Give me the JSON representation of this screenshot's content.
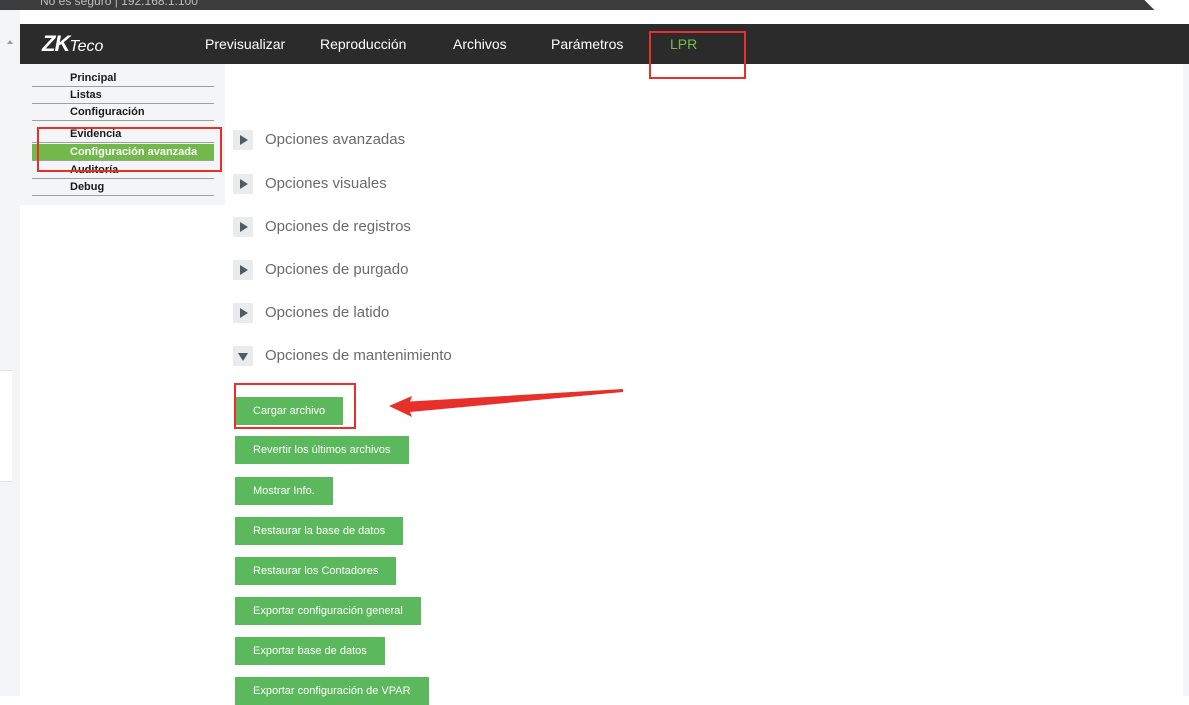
{
  "browser": {
    "address_text": "No es seguro | 192.168.1.100"
  },
  "brand": {
    "logo_zk": "ZK",
    "logo_teco": "Teco",
    "accent_color": "#6fbf4f",
    "button_color": "#5cb85c",
    "annotation_color": "#e8302a"
  },
  "nav": {
    "items": [
      {
        "label": "Previsualizar",
        "active": false
      },
      {
        "label": "Reproducción",
        "active": false
      },
      {
        "label": "Archivos",
        "active": false
      },
      {
        "label": "Parámetros",
        "active": false
      },
      {
        "label": "LPR",
        "active": true
      }
    ]
  },
  "sidebar": {
    "items": [
      {
        "label": "Principal",
        "active": false
      },
      {
        "label": "Listas",
        "active": false
      },
      {
        "label": "Configuración",
        "active": false
      },
      {
        "label": "Evidencia",
        "active": false
      },
      {
        "label": "Configuración avanzada",
        "active": true
      },
      {
        "label": "Auditoría",
        "active": false
      },
      {
        "label": "Debug",
        "active": false
      }
    ]
  },
  "sections": [
    {
      "label": "Opciones avanzadas",
      "expanded": false,
      "icon": "chevron-right-icon"
    },
    {
      "label": "Opciones visuales",
      "expanded": false,
      "icon": "chevron-right-icon"
    },
    {
      "label": "Opciones de registros",
      "expanded": false,
      "icon": "chevron-right-icon"
    },
    {
      "label": "Opciones de purgado",
      "expanded": false,
      "icon": "chevron-right-icon"
    },
    {
      "label": "Opciones de latido",
      "expanded": false,
      "icon": "chevron-right-icon"
    },
    {
      "label": "Opciones de mantenimiento",
      "expanded": true,
      "icon": "chevron-down-icon"
    }
  ],
  "maintenance": {
    "buttons": [
      {
        "label": "Cargar archivo"
      },
      {
        "label": "Revertir los últimos archivos"
      },
      {
        "label": "Mostrar Info."
      },
      {
        "label": "Restaurar la base de datos"
      },
      {
        "label": "Restaurar los Contadores"
      },
      {
        "label": "Exportar configuración general"
      },
      {
        "label": "Exportar base de datos"
      },
      {
        "label": "Exportar configuración de VPAR"
      }
    ]
  }
}
